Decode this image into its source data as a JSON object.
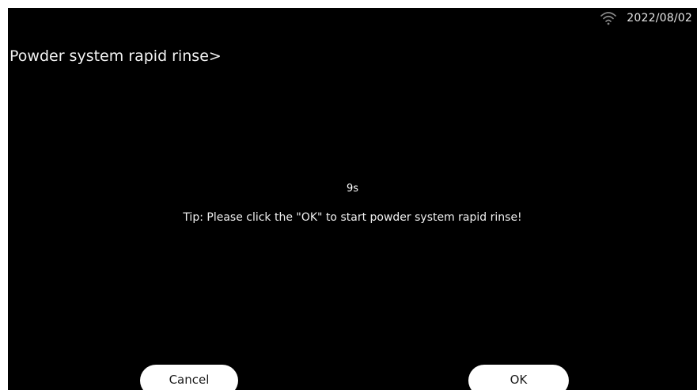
{
  "status_bar": {
    "wifi_icon": "wifi-icon",
    "date": "2022/08/02"
  },
  "page": {
    "title": "Powder system rapid rinse>",
    "countdown": "9s",
    "tip": "Tip: Please click the \"OK\" to start powder system rapid rinse!"
  },
  "buttons": {
    "cancel_label": "Cancel",
    "ok_label": "OK"
  },
  "colors": {
    "background": "#000000",
    "text": "#ffffff",
    "button_bg": "#ffffff",
    "button_text": "#1a1a1a"
  }
}
